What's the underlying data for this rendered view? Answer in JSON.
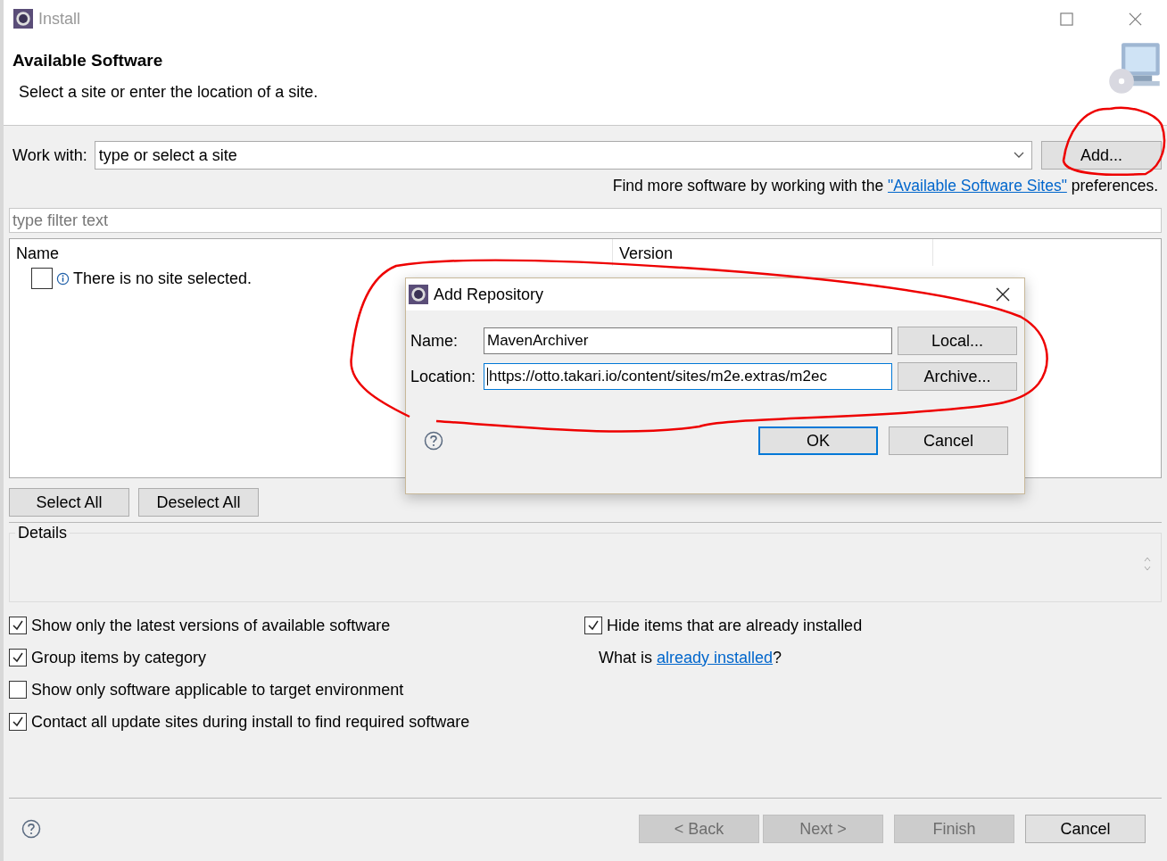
{
  "window": {
    "title": "Install"
  },
  "header": {
    "title": "Available Software",
    "subtitle": "Select a site or enter the location of a site."
  },
  "work_with": {
    "label": "Work with:",
    "value": "type or select a site",
    "button": "Add..."
  },
  "hint": {
    "before": "Find more software by working with the ",
    "link": "\"Available Software Sites\"",
    "after": " preferences."
  },
  "filter": {
    "placeholder": "type filter text"
  },
  "table": {
    "columns": [
      "Name",
      "Version"
    ],
    "rows": [
      {
        "checked": false,
        "text": "There is no site selected."
      }
    ]
  },
  "selection_buttons": [
    "Select All",
    "Deselect All"
  ],
  "details": {
    "title": "Details"
  },
  "options_left": [
    {
      "label": "Show only the latest versions of available software",
      "checked": true
    },
    {
      "label": "Group items by category",
      "checked": true
    },
    {
      "label": "Show only software applicable to target environment",
      "checked": false
    },
    {
      "label": "Contact all update sites during install to find required software",
      "checked": true
    }
  ],
  "options_right": [
    {
      "label": "Hide items that are already installed",
      "checked": true
    }
  ],
  "installed_note": {
    "before": "What is ",
    "link": "already installed",
    "after": "?"
  },
  "dialog": {
    "title": "Add Repository",
    "fields": [
      {
        "label": "Name:",
        "value": "MavenArchiver",
        "button": "Local...",
        "focused": false
      },
      {
        "label": "Location:",
        "value": "https://otto.takari.io/content/sites/m2e.extras/m2ec",
        "button": "Archive...",
        "focused": true
      }
    ],
    "buttons": [
      {
        "label": "OK",
        "default": true
      },
      {
        "label": "Cancel",
        "default": false
      }
    ]
  },
  "footer": {
    "buttons": [
      {
        "label": "< Back",
        "disabled": true
      },
      {
        "label": "Next >",
        "disabled": true
      },
      {
        "label": "Finish",
        "disabled": true
      },
      {
        "label": "Cancel",
        "disabled": false
      }
    ]
  }
}
